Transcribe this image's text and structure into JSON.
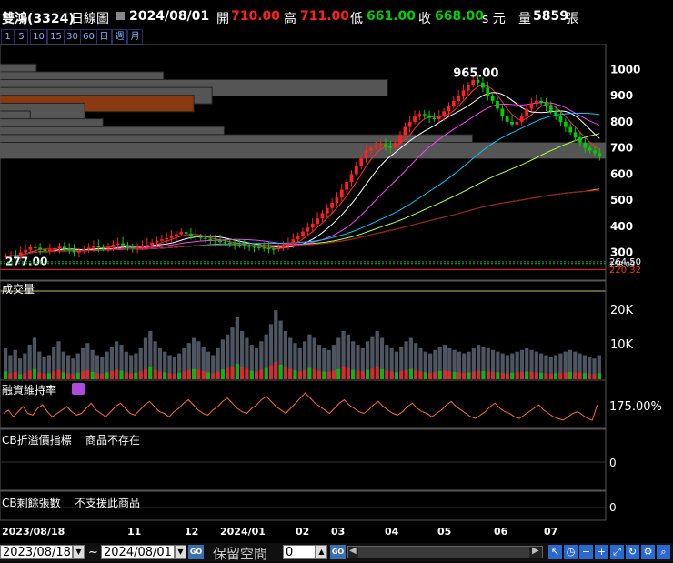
{
  "header": {
    "title": "雙鴻(3324)",
    "chart_type": "日線圖",
    "date": "2024/08/01",
    "open_label": "開",
    "open": "710.00",
    "high_label": "高",
    "high": "711.00",
    "low_label": "低",
    "low": "661.00",
    "close_label": "收",
    "close": "668.00",
    "unit": "s 元",
    "volume_label": "量",
    "volume": "5859",
    "volume_unit": "張"
  },
  "timeframes": [
    "1",
    "5",
    "10",
    "15",
    "30",
    "60",
    "日",
    "週",
    "月"
  ],
  "panels": {
    "volume_title": "成交量",
    "margin_title": "融資維持率",
    "cb_premium_title": "CB折溢價指標",
    "cb_premium_note": "商品不存在",
    "cb_remain_title": "CB剩餘張數",
    "cb_remain_note": "不支援此商品"
  },
  "chart_data": [
    {
      "type": "candlestick",
      "name": "price",
      "y_ticks": [
        "1000",
        "900",
        "800",
        "700",
        "600",
        "500",
        "400",
        "300"
      ],
      "ylim": [
        250,
        1050
      ],
      "max_label": "965.00",
      "min_label": "277.00",
      "ref_labels": [
        "264.50",
        "258.09",
        "220.32"
      ],
      "x_tick_labels": [
        "2023/08/18",
        "11",
        "12",
        "2024/01",
        "02",
        "03",
        "04",
        "05",
        "06",
        "07"
      ],
      "closes": [
        285,
        290,
        288,
        300,
        310,
        320,
        318,
        312,
        305,
        310,
        316,
        322,
        315,
        308,
        300,
        305,
        312,
        318,
        325,
        320,
        315,
        322,
        330,
        335,
        328,
        320,
        316,
        318,
        325,
        330,
        338,
        345,
        350,
        355,
        362,
        370,
        378,
        372,
        365,
        360,
        356,
        352,
        348,
        345,
        340,
        338,
        335,
        330,
        328,
        325,
        322,
        320,
        318,
        316,
        314,
        312,
        318,
        325,
        335,
        350,
        365,
        380,
        395,
        410,
        430,
        450,
        470,
        490,
        510,
        540,
        570,
        600,
        630,
        660,
        690,
        700,
        710,
        715,
        705,
        700,
        720,
        750,
        780,
        800,
        820,
        830,
        825,
        815,
        810,
        820,
        840,
        860,
        880,
        900,
        920,
        940,
        960,
        950,
        930,
        900,
        880,
        850,
        820,
        800,
        790,
        800,
        820,
        850,
        870,
        880,
        875,
        860,
        840,
        820,
        800,
        780,
        760,
        740,
        720,
        700,
        690,
        680,
        668
      ],
      "ma_series": [
        {
          "color": "#ff3030",
          "period": 5
        },
        {
          "color": "#ffffff",
          "period": 10
        },
        {
          "color": "#ff3cff",
          "period": 20
        },
        {
          "color": "#00c8ff",
          "period": 40
        },
        {
          "color": "#b0ff40",
          "period": 60
        },
        {
          "color": "#d09a4a",
          "period": 120
        },
        {
          "color": "#a01818",
          "period": 240
        }
      ],
      "volume_profile": [
        {
          "price": 990,
          "length": 0.06
        },
        {
          "price": 960,
          "length": 0.27
        },
        {
          "price": 930,
          "length": 0.64
        },
        {
          "price": 900,
          "length": 0.35
        },
        {
          "price": 870,
          "length": 0.32,
          "highlight": true
        },
        {
          "price": 840,
          "length": 0.14
        },
        {
          "price": 810,
          "length": 0.05
        },
        {
          "price": 780,
          "length": 0.17
        },
        {
          "price": 750,
          "length": 0.37
        },
        {
          "price": 720,
          "length": 0.78
        },
        {
          "price": 690,
          "length": 1.0
        }
      ]
    },
    {
      "type": "bar",
      "name": "volume",
      "y_ticks": [
        "20K",
        "10K"
      ],
      "ylim": [
        0,
        24000
      ],
      "values": [
        9000,
        7000,
        8500,
        6000,
        7500,
        10000,
        12000,
        8000,
        6500,
        7000,
        9500,
        11000,
        8000,
        7000,
        6000,
        7500,
        9000,
        10500,
        8500,
        7000,
        6500,
        8000,
        9500,
        11000,
        10000,
        8000,
        7000,
        7500,
        9000,
        12000,
        14000,
        11000,
        9000,
        8000,
        7000,
        6500,
        7500,
        9000,
        10500,
        12000,
        11000,
        9500,
        8000,
        7000,
        9000,
        11500,
        13000,
        15000,
        18000,
        14000,
        12000,
        10000,
        9000,
        11000,
        13000,
        16000,
        20000,
        17000,
        14000,
        12000,
        10500,
        9000,
        11000,
        13000,
        12000,
        10000,
        9000,
        8500,
        10000,
        12000,
        14000,
        13000,
        11000,
        10000,
        9000,
        11000,
        12500,
        14000,
        12000,
        10000,
        9000,
        8000,
        9500,
        11000,
        12000,
        10500,
        9000,
        8000,
        7500,
        8500,
        9500,
        10000,
        9000,
        8500,
        8000,
        7500,
        8000,
        9000,
        10000,
        9500,
        9000,
        8500,
        8000,
        7500,
        7000,
        7500,
        8000,
        8500,
        9000,
        8500,
        8000,
        7500,
        7000,
        6500,
        7000,
        7500,
        8000,
        8500,
        8000,
        7500,
        7000,
        6500,
        6000,
        7000
      ]
    },
    {
      "type": "line",
      "name": "margin_ratio",
      "last_label": "175.00%",
      "values": [
        170,
        172,
        168,
        171,
        174,
        170,
        169,
        173,
        175,
        171,
        168,
        170,
        172,
        174,
        171,
        169,
        170,
        173,
        176,
        172,
        170,
        168,
        171,
        174,
        176,
        173,
        170,
        169,
        172,
        175,
        177,
        174,
        171,
        170,
        168,
        171,
        173,
        176,
        178,
        175,
        172,
        170,
        169,
        172,
        174,
        177,
        179,
        176,
        173,
        171,
        170,
        173,
        175,
        178,
        180,
        177,
        174,
        172,
        170,
        173,
        176,
        179,
        182,
        179,
        176,
        174,
        172,
        170,
        173,
        176,
        178,
        175,
        173,
        171,
        170,
        172,
        175,
        177,
        174,
        172,
        170,
        169,
        171,
        174,
        176,
        173,
        171,
        170,
        168,
        170,
        172,
        175,
        177,
        174,
        172,
        170,
        168,
        167,
        169,
        171,
        174,
        176,
        173,
        171,
        170,
        168,
        167,
        169,
        171,
        173,
        175,
        172,
        170,
        168,
        167,
        166,
        168,
        170,
        171,
        169,
        167,
        166,
        175
      ]
    },
    {
      "type": "line",
      "name": "cb_premium",
      "y_ticks": [
        "0"
      ]
    },
    {
      "type": "line",
      "name": "cb_remain",
      "y_ticks": [
        "0"
      ]
    }
  ],
  "footer": {
    "from_date": "2023/08/18",
    "tilde": "~",
    "to_date": "2024/08/01",
    "go_label": "GO",
    "reserve_label": "保留空間",
    "reserve_value": "0",
    "toolbar_icons": [
      "cursor-arrow-icon",
      "clock-icon",
      "zoom-out-icon",
      "zoom-in-icon",
      "expand-icon",
      "refresh-icon",
      "settings-icon",
      "zoom-search-icon"
    ]
  },
  "colors": {
    "up": "#ff2020",
    "down": "#00d000",
    "value_white": "#ffffff",
    "volume_bar": "#4c5560",
    "panel_border": "#555555"
  }
}
